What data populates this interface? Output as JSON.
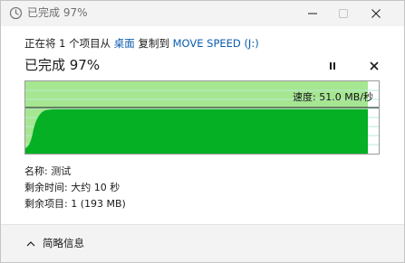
{
  "window": {
    "title": "已完成 97%",
    "icon": "copy-progress-icon"
  },
  "copy": {
    "prefix": "正在将 1 个项目从",
    "source": "桌面",
    "middle": "复制到",
    "destination": "MOVE SPEED (J:)",
    "heading": "已完成 97%",
    "progress_percent": 97
  },
  "graph": {
    "speed_label": "速度: 51.0 MB/秒",
    "fill_color": "#06b025",
    "bg_color": "#a6e691"
  },
  "details": {
    "name_label": "名称:",
    "name_value": "测试",
    "time_label": "剩余时间:",
    "time_value": "大约 10 秒",
    "items_label": "剩余项目:",
    "items_value": "1 (193 MB)"
  },
  "footer": {
    "toggle_label": "简略信息"
  }
}
